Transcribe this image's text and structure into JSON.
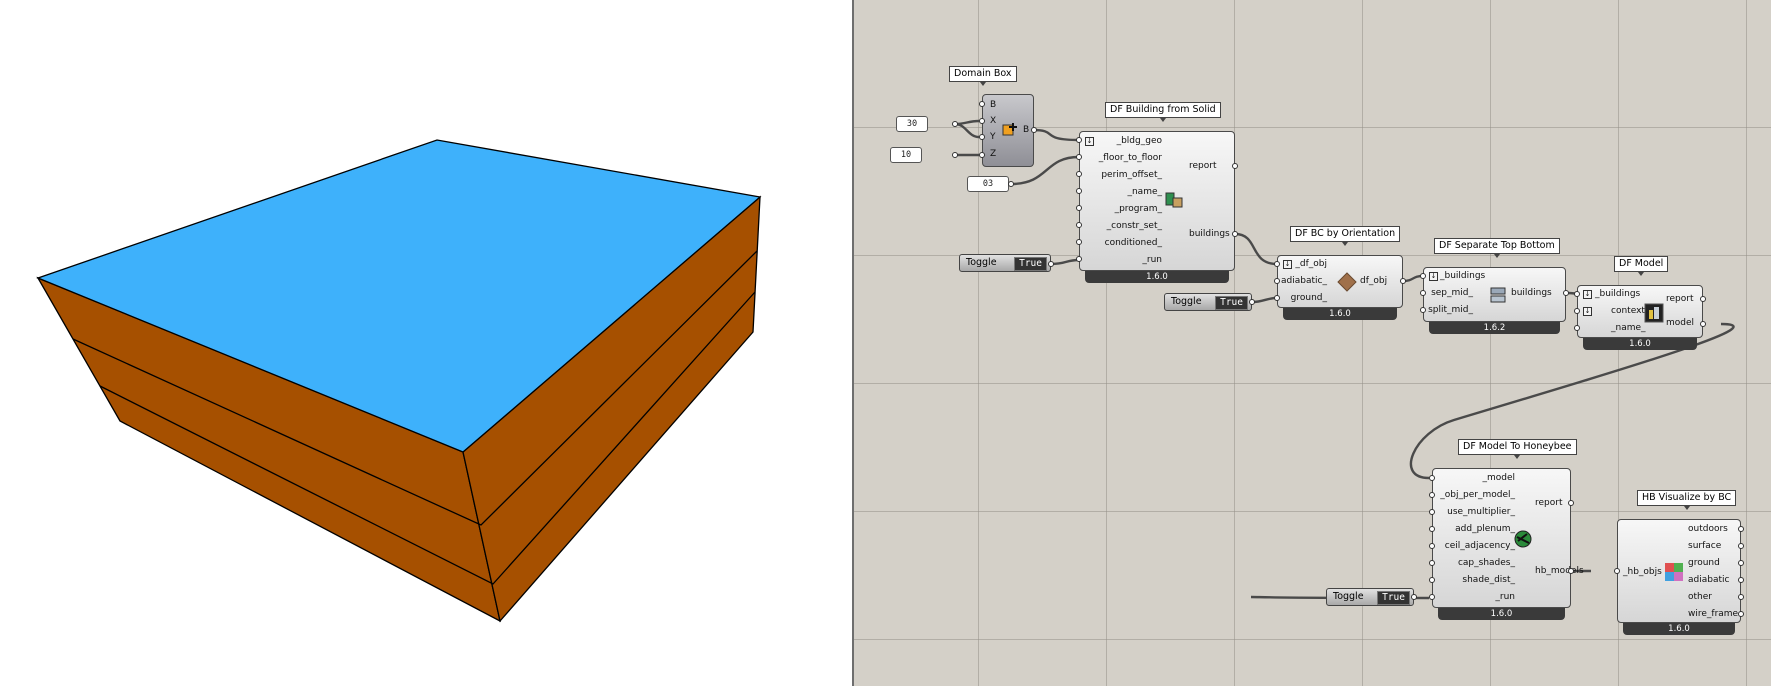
{
  "colors": {
    "roof": "#3eb1fb",
    "walls": "#a65000",
    "canvas": "#d4d0c8"
  },
  "viewport": {
    "description_icon": "3d-building-massing"
  },
  "domain_box": {
    "title": "Domain Box",
    "inputs": [
      "B",
      "X",
      "Y",
      "Z"
    ],
    "output": "B"
  },
  "sliders": {
    "x": "30",
    "z": "10",
    "perim": "03"
  },
  "df_building": {
    "title": "DF Building from Solid",
    "inputs": [
      "_bldg_geo",
      "_floor_to_floor",
      "perim_offset_",
      "_name_",
      "_program_",
      "_constr_set_",
      "conditioned_",
      "_run"
    ],
    "outputs": [
      "report",
      "buildings"
    ],
    "version": "1.6.0"
  },
  "toggle1": {
    "label": "Toggle",
    "value": "True"
  },
  "df_bc": {
    "title": "DF BC by Orientation",
    "inputs": [
      "_df_obj",
      "adiabatic_",
      "ground_"
    ],
    "outputs": [
      "df_obj"
    ],
    "version": "1.6.0"
  },
  "toggle2": {
    "label": "Toggle",
    "value": "True"
  },
  "df_sep": {
    "title": "DF Separate Top Bottom",
    "inputs": [
      "_buildings",
      "sep_mid_",
      "split_mid_"
    ],
    "outputs": [
      "buildings"
    ],
    "version": "1.6.2"
  },
  "df_model": {
    "title": "DF Model",
    "inputs": [
      "_buildings",
      "context_",
      "_name_"
    ],
    "outputs": [
      "report",
      "model"
    ],
    "version": "1.6.0"
  },
  "df_to_hb": {
    "title": "DF Model To Honeybee",
    "inputs": [
      "_model",
      "_obj_per_model_",
      "use_multiplier_",
      "add_plenum_",
      "ceil_adjacency_",
      "cap_shades_",
      "shade_dist_",
      "_run"
    ],
    "outputs": [
      "report",
      "hb_models"
    ],
    "version": "1.6.0"
  },
  "toggle3": {
    "label": "Toggle",
    "value": "True"
  },
  "hb_vis": {
    "title": "HB Visualize by BC",
    "inputs": [
      "_hb_objs"
    ],
    "outputs": [
      "outdoors",
      "surface",
      "ground",
      "adiabatic",
      "other",
      "wire_frame"
    ],
    "version": "1.6.0"
  }
}
